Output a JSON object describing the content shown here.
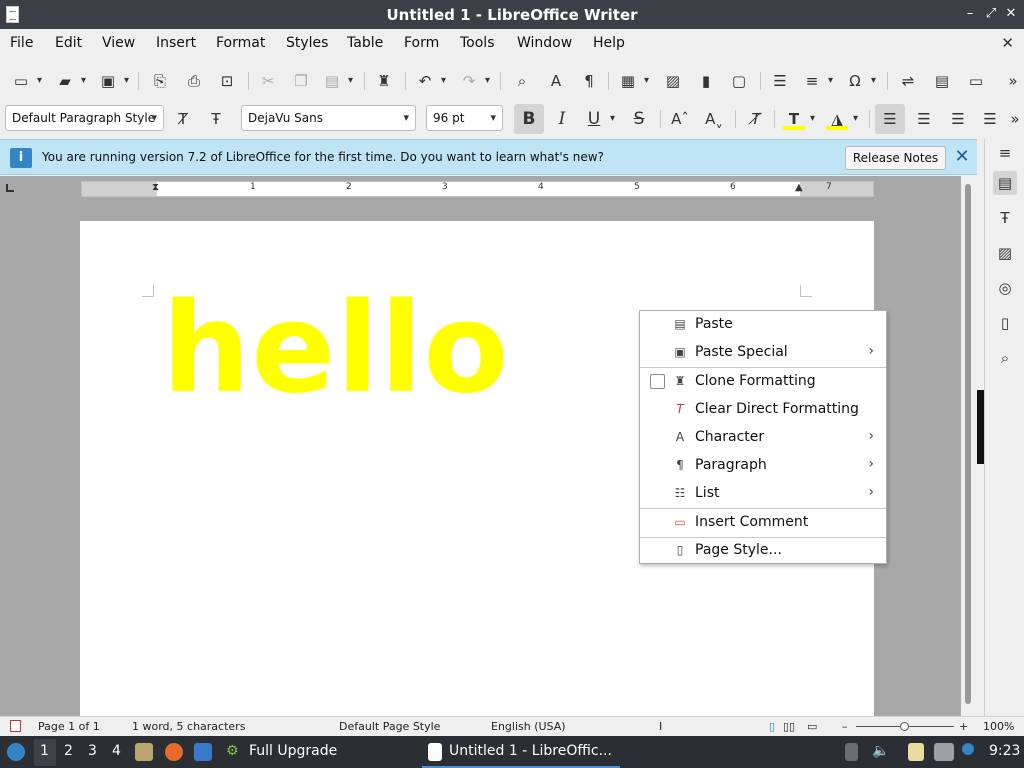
{
  "window": {
    "title": "Untitled 1 - LibreOffice Writer",
    "buttons": {
      "minimize": "–",
      "restore": "⤢",
      "close": "✕"
    }
  },
  "menubar": {
    "items": [
      "File",
      "Edit",
      "View",
      "Insert",
      "Format",
      "Styles",
      "Table",
      "Form",
      "Tools",
      "Window",
      "Help"
    ],
    "close_document": "✕"
  },
  "toolbar_standard": {
    "icons": [
      "new-icon",
      "open-icon",
      "save-icon",
      "export-pdf-icon",
      "print-icon",
      "print-preview-icon",
      "cut-icon",
      "copy-icon",
      "paste-icon",
      "clone-formatting-icon",
      "undo-icon",
      "redo-icon",
      "find-replace-icon",
      "spelling-icon",
      "formatting-marks-icon",
      "insert-table-icon",
      "insert-image-icon",
      "insert-chart-icon",
      "insert-textbox-icon",
      "page-break-icon",
      "insert-field-icon",
      "special-character-icon",
      "hyperlink-icon",
      "footnote-icon",
      "comment-icon",
      "more-icon"
    ]
  },
  "toolbar_formatting": {
    "paragraph_style": "Default Paragraph Style",
    "font_name": "DejaVu Sans",
    "font_size": "96 pt",
    "bold": "B",
    "italic": "I",
    "underline": "U",
    "strikethrough": "S",
    "font_color_hex": "#ffff00",
    "highlight_color_hex": "#ffff00"
  },
  "infobar": {
    "message": "You are running version 7.2 of LibreOffice for the first time. Do you want to learn what's new?",
    "release_notes_label": "Release Notes",
    "close": "✕",
    "accent": "#bfe4f5"
  },
  "ruler": {
    "numbers": [
      "1",
      "2",
      "3",
      "4",
      "5",
      "6",
      "7"
    ]
  },
  "document": {
    "text": "hello",
    "text_color": "#ffff00"
  },
  "context_menu": {
    "items": [
      {
        "label": "Paste",
        "icon": "paste-icon",
        "submenu": false
      },
      {
        "label": "Paste Special",
        "icon": "paste-special-icon",
        "submenu": true
      },
      {
        "label": "Clone Formatting",
        "icon": "clone-formatting-icon",
        "submenu": false,
        "checkbox": true
      },
      {
        "label": "Clear Direct Formatting",
        "icon": "clear-formatting-icon",
        "submenu": false
      },
      {
        "label": "Character",
        "icon": "character-icon",
        "submenu": true
      },
      {
        "label": "Paragraph",
        "icon": "paragraph-icon",
        "submenu": true
      },
      {
        "label": "List",
        "icon": "list-icon",
        "submenu": true
      },
      {
        "label": "Insert Comment",
        "icon": "comment-icon",
        "submenu": false
      },
      {
        "label": "Page Style...",
        "icon": "page-style-icon",
        "submenu": false
      }
    ],
    "submenu_glyph": "›"
  },
  "statusbar": {
    "page": "Page 1 of 1",
    "words": "1 word, 5 characters",
    "page_style": "Default Page Style",
    "language": "English (USA)",
    "zoom_minus": "–",
    "zoom_plus": "+",
    "zoom": "100%"
  },
  "taskbar": {
    "workspaces": [
      "1",
      "2",
      "3",
      "4"
    ],
    "tasks": [
      "Full Upgrade",
      "Untitled 1 - LibreOffic..."
    ],
    "clock": "9:23"
  }
}
